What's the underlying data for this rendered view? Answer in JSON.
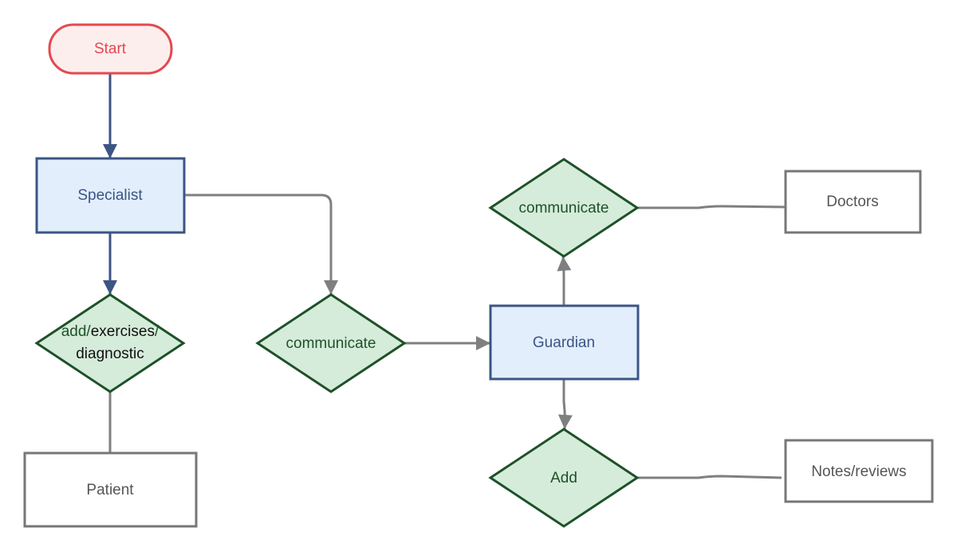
{
  "colors": {
    "terminal_stroke": "#e5484d",
    "terminal_fill": "#fdeeee",
    "process_stroke": "#3b5584",
    "process_fill": "#e2eefc",
    "decision_stroke": "#1e5128",
    "decision_fill": "#d5ecda",
    "decision_text": "#1e5128",
    "entity_stroke": "#777777",
    "entity_text": "#555555",
    "connector_gray": "#7f7f7f",
    "connector_navy": "#3b5584"
  },
  "nodes": {
    "start": "Start",
    "specialist": "Specialist",
    "decision_add_part1": "add/",
    "decision_add_part2": "exercises",
    "decision_add_part3": "/",
    "decision_add_line2": "diagnostic",
    "patient": "Patient",
    "communicate_1": "communicate",
    "guardian": "Guardian",
    "communicate_2": "communicate",
    "doctors": "Doctors",
    "add": "Add",
    "notes": "Notes/reviews"
  }
}
